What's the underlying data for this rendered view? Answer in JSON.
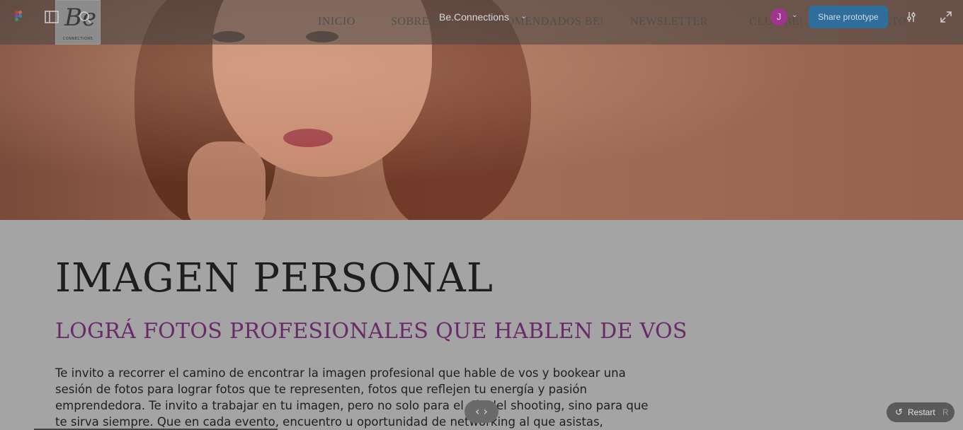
{
  "figma": {
    "file_title": "Be.Connections",
    "avatar_initial": "J",
    "share_label": "Share prototype",
    "restart_label": "Restart",
    "restart_key": "R"
  },
  "site": {
    "logo_mark": "Be",
    "logo_sub": "CONNECTIONS",
    "nav": [
      "INICIO",
      "SOBRE BE!",
      "RECOMENDADOS BE!",
      "NEWSLETTER",
      "CLUB BE!",
      "CONTACTO"
    ]
  },
  "content": {
    "title": "IMAGEN PERSONAL",
    "subtitle": "LOGRÁ FOTOS PROFESIONALES QUE HABLEN DE VOS",
    "body": "Te invito a recorrer el camino de encontrar la imagen profesional que hable de vos y bookear una sesión de fotos para lograr fotos que te representen, fotos que reflejen tu energía y pasión emprendedora. Te invito a trabajar en tu imagen, pero no solo para el día del shooting, sino para que te sirva siempre. Que en cada evento, encuentro u oportunidad de networking al que asistas,"
  },
  "colors": {
    "accent_subtitle": "#6a2a6a",
    "share_button": "#2f6e9a",
    "avatar": "#a03590"
  },
  "icons": {
    "figma_logo": "figma-logo-icon",
    "sidebar": "sidebar-toggle-icon",
    "search": "search-icon",
    "settings": "sliders-icon",
    "fullscreen": "expand-icon",
    "prev": "chevron-left-icon",
    "next": "chevron-right-icon",
    "restart": "restart-icon"
  }
}
